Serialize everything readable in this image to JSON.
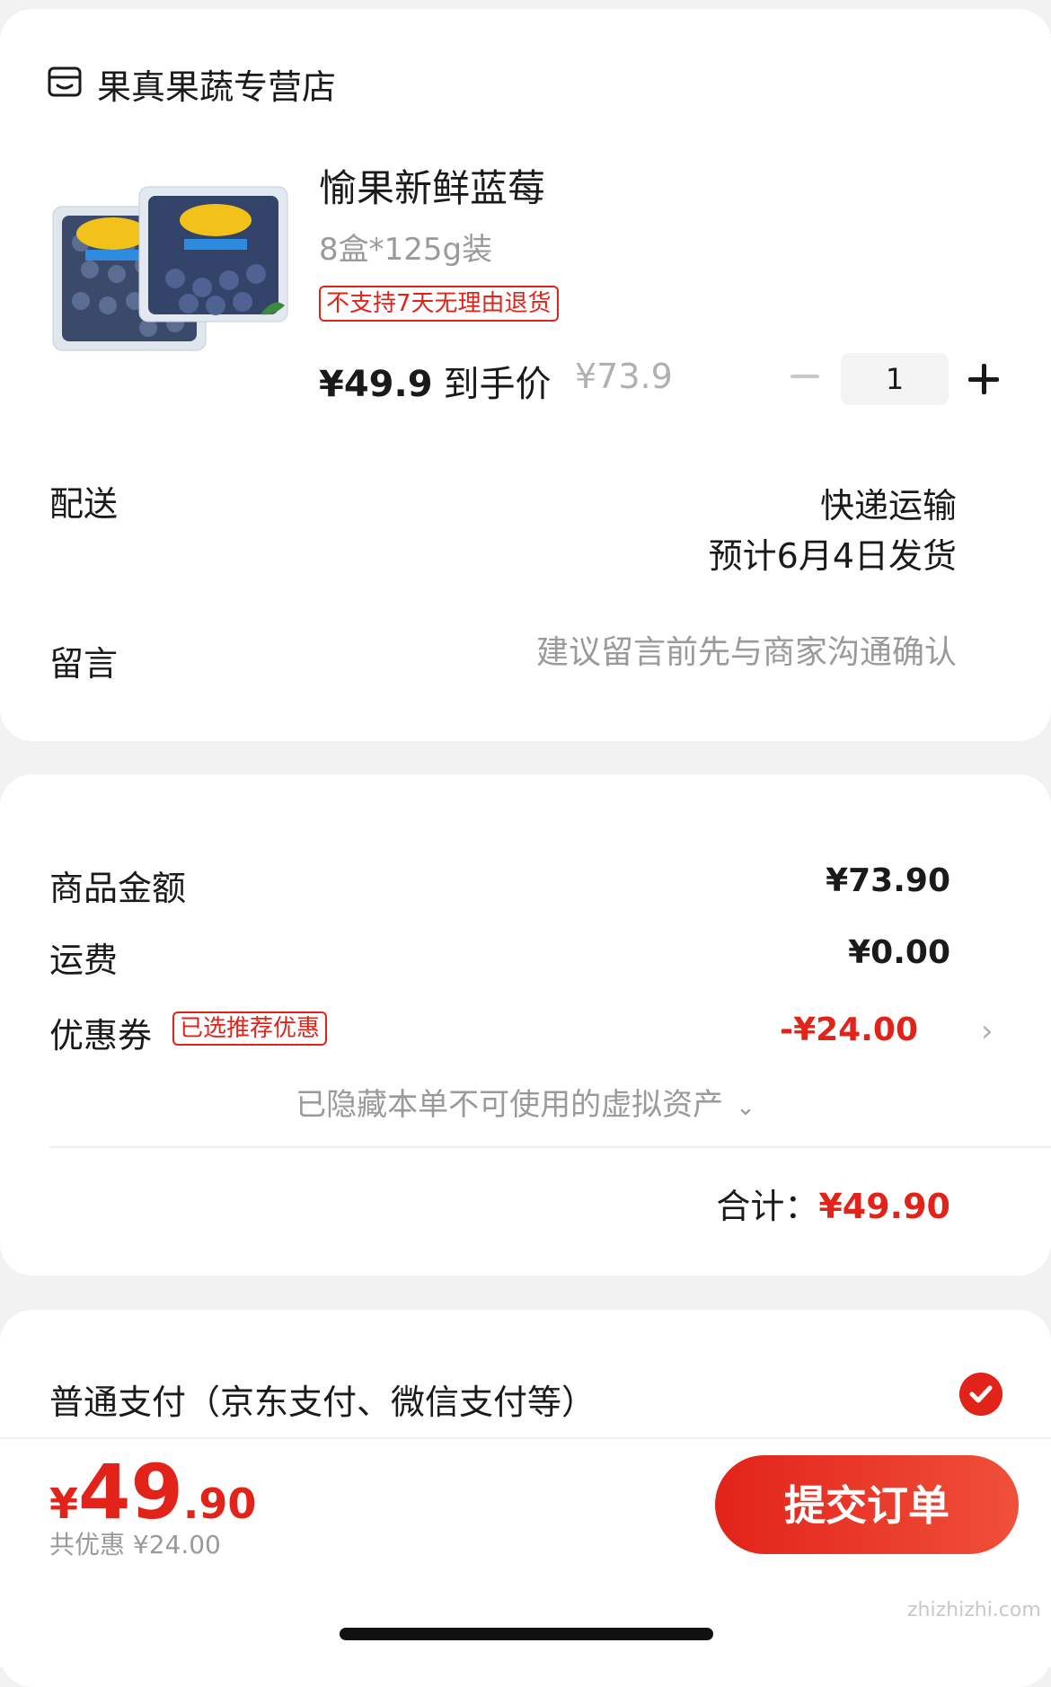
{
  "store": {
    "name": "果真果蔬专营店",
    "icon": "store-icon"
  },
  "product": {
    "title": "愉果新鲜蓝莓",
    "spec": "8盒*125g装",
    "tag": "不支持7天无理由退货",
    "price": "¥49.9",
    "price_label": "到手价",
    "original_price": "¥73.9",
    "quantity": "1"
  },
  "shipping": {
    "label": "配送",
    "method": "快递运输",
    "estimate": "预计6月4日发货"
  },
  "message": {
    "label": "留言",
    "placeholder": "建议留言前先与商家沟通确认"
  },
  "summary": {
    "goods_label": "商品金额",
    "goods_value": "¥73.90",
    "freight_label": "运费",
    "freight_value": "¥0.00",
    "coupon_label": "优惠券",
    "coupon_tag": "已选推荐优惠",
    "coupon_value": "-¥24.00",
    "hidden_assets": "已隐藏本单不可使用的虚拟资产",
    "total_label": "合计：",
    "total_value": "¥49.90"
  },
  "payment": {
    "method": "普通支付（京东支付、微信支付等）",
    "selected": true
  },
  "bottom": {
    "price_symbol": "¥",
    "price_int": "49",
    "price_dec": ".90",
    "saved": "共优惠 ¥24.00",
    "submit": "提交订单"
  },
  "watermark": "zhizhizhi.com",
  "colors": {
    "accent": "#e2231a",
    "muted": "#9a9a9a"
  }
}
